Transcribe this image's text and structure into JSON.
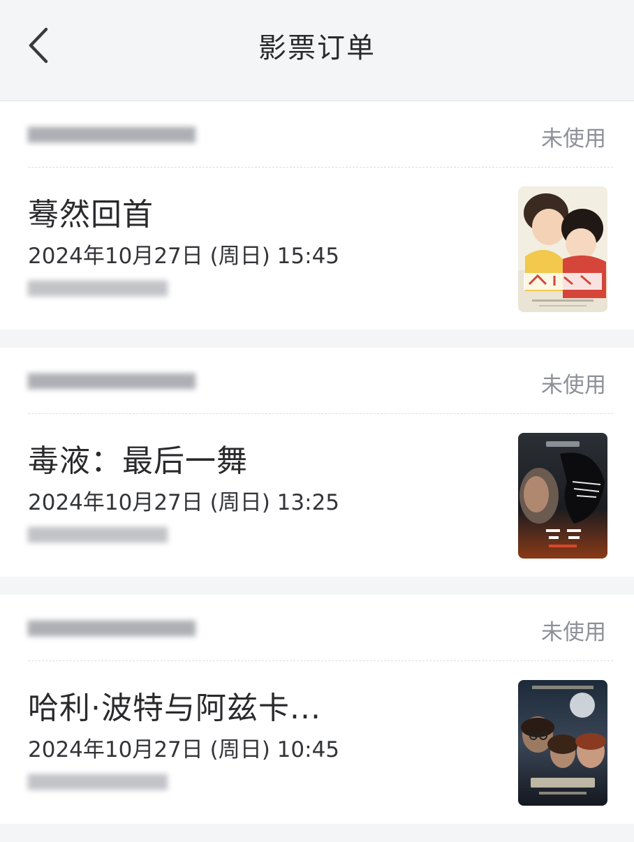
{
  "header": {
    "title": "影票订单",
    "back_icon": "chevron-left-icon"
  },
  "orders": [
    {
      "status": "未使用",
      "movie_title": "蓦然回首",
      "showtime": "2024年10月27日 (周日) 15:45",
      "poster_icon": "movie-poster-look-back"
    },
    {
      "status": "未使用",
      "movie_title": "毒液：最后一舞",
      "showtime": "2024年10月27日 (周日) 13:25",
      "poster_icon": "movie-poster-venom"
    },
    {
      "status": "未使用",
      "movie_title": "哈利·波特与阿兹卡...",
      "showtime": "2024年10月27日 (周日) 10:45",
      "poster_icon": "movie-poster-harry-potter"
    }
  ]
}
